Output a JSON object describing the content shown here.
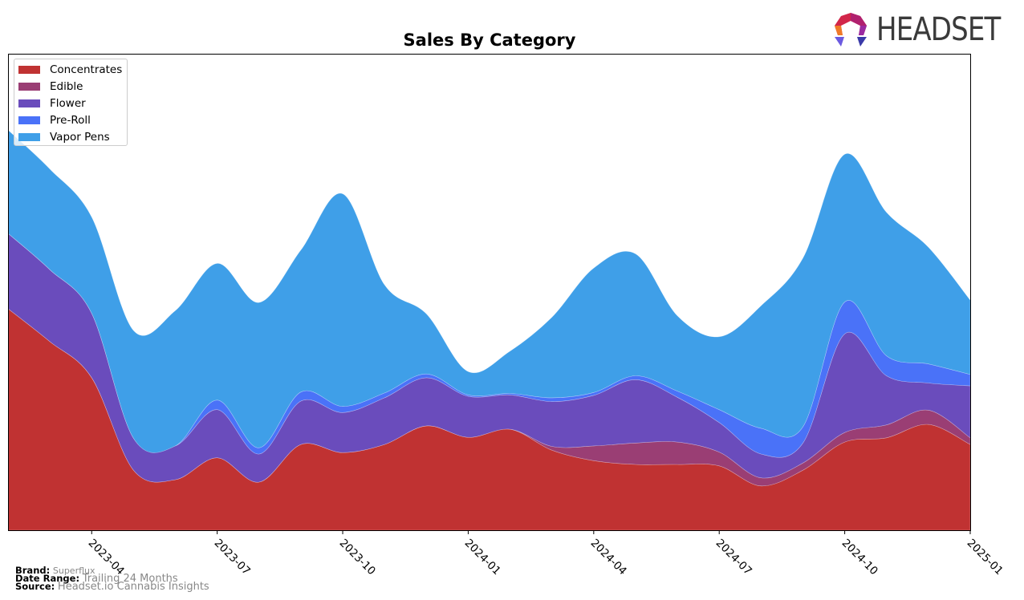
{
  "logo": {
    "text": "HEADSET"
  },
  "chart_data": {
    "type": "area",
    "stacked": true,
    "title": "Sales By Category",
    "xlabel": "",
    "ylabel": "",
    "ylim": [
      0,
      100
    ],
    "grid": false,
    "legend_position": "top-left",
    "x": [
      "2023-02",
      "2023-03",
      "2023-04",
      "2023-05",
      "2023-06",
      "2023-07",
      "2023-08",
      "2023-09",
      "2023-10",
      "2023-11",
      "2023-12",
      "2024-01",
      "2024-02",
      "2024-03",
      "2024-04",
      "2024-05",
      "2024-06",
      "2024-07",
      "2024-08",
      "2024-09",
      "2024-10",
      "2024-11",
      "2024-12",
      "2025-01"
    ],
    "x_ticks": [
      "2023-04",
      "2023-07",
      "2023-10",
      "2024-01",
      "2024-04",
      "2024-07",
      "2024-10",
      "2025-01"
    ],
    "series": [
      {
        "name": "Concentrates",
        "color": "#c03232",
        "values": [
          46.5,
          39.6,
          32.0,
          12.6,
          10.6,
          15.2,
          10.1,
          18.0,
          16.3,
          18.0,
          21.9,
          19.5,
          21.2,
          16.8,
          14.6,
          13.8,
          13.8,
          13.5,
          9.3,
          12.6,
          18.5,
          19.4,
          22.2,
          18.0
        ]
      },
      {
        "name": "Edible",
        "color": "#9a3e74",
        "values": [
          0,
          0,
          0,
          0,
          0,
          0,
          0,
          0,
          0,
          0,
          0,
          0,
          0,
          0.8,
          3.1,
          4.5,
          4.7,
          2.9,
          1.7,
          1.5,
          2.0,
          2.7,
          3.0,
          1.4
        ]
      },
      {
        "name": "Flower",
        "color": "#6a4cbc",
        "values": [
          15.8,
          15.1,
          13.5,
          6.7,
          7.1,
          10.1,
          5.9,
          9.1,
          8.4,
          9.8,
          10.1,
          8.6,
          7.2,
          9.4,
          10.6,
          13.3,
          9.4,
          6.2,
          5.0,
          4.2,
          20.7,
          10.3,
          5.7,
          10.9
        ]
      },
      {
        "name": "Pre-Roll",
        "color": "#4a72f8",
        "values": [
          0,
          0,
          0,
          0,
          0,
          2.0,
          1.3,
          1.9,
          1.3,
          1.0,
          0.8,
          0.3,
          0.3,
          0.8,
          0.6,
          0.8,
          1.3,
          2.7,
          5.4,
          3.4,
          6.7,
          4.2,
          4.0,
          2.4
        ]
      },
      {
        "name": "Vapor Pens",
        "color": "#3f9fe8",
        "values": [
          21.7,
          21.1,
          20.2,
          22.6,
          28.4,
          28.7,
          30.5,
          29.8,
          44.6,
          22.7,
          12.6,
          4.9,
          8.9,
          16.9,
          26.1,
          25.6,
          15.8,
          15.3,
          25.7,
          35.4,
          31.0,
          30.1,
          24.5,
          15.6
        ]
      }
    ]
  },
  "footer": {
    "brand_label": "Brand:",
    "brand_value": "Superflux",
    "range_label": "Date Range:",
    "range_value": "Trailing 24 Months",
    "source_label": "Source:",
    "source_value": "Headset.io Cannabis Insights"
  }
}
